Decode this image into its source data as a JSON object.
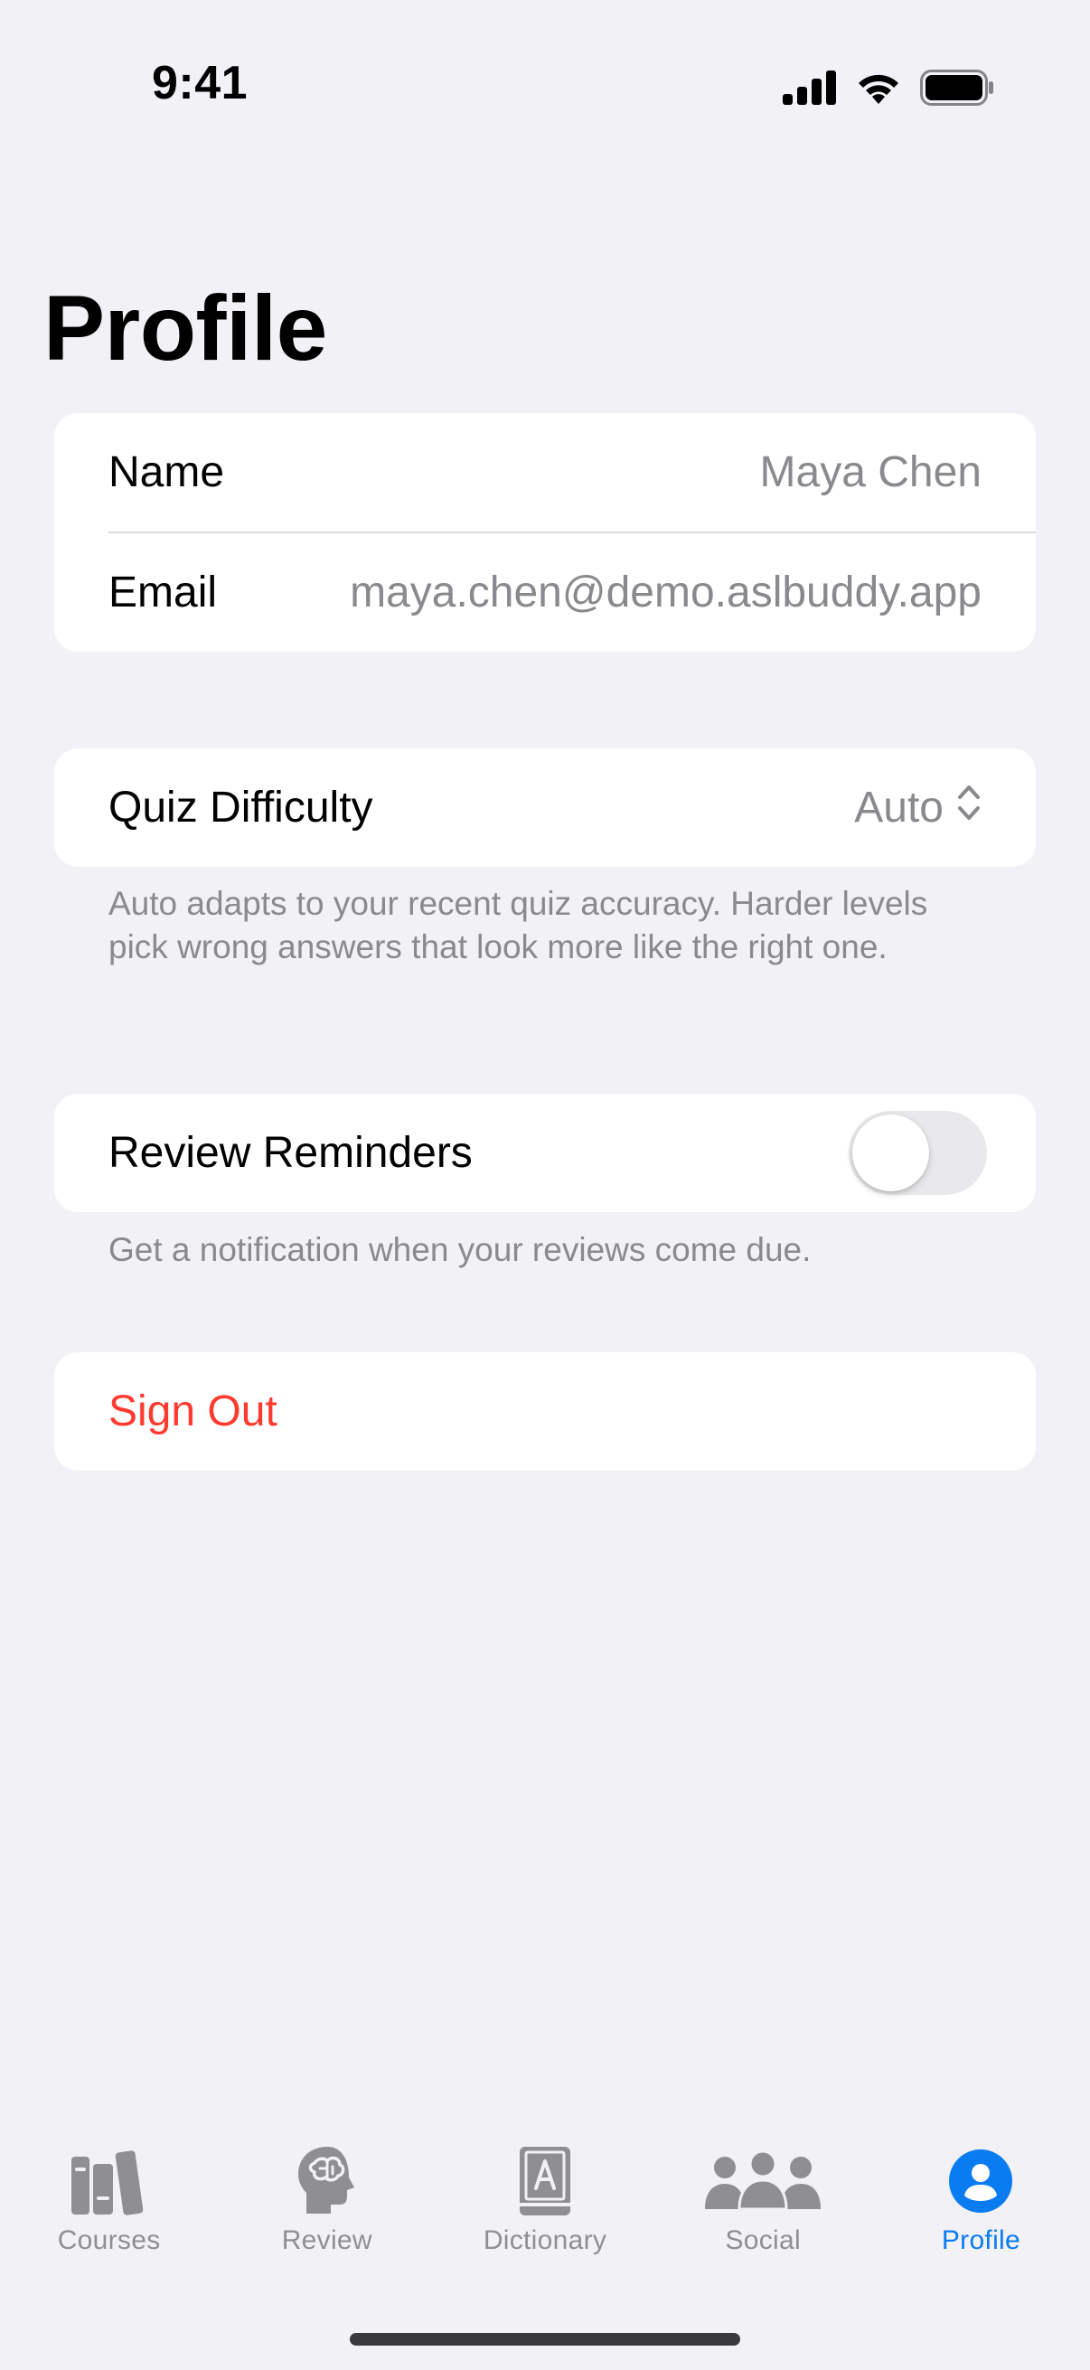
{
  "status_bar": {
    "time": "9:41"
  },
  "page": {
    "title": "Profile"
  },
  "account": {
    "name_label": "Name",
    "name_value": "Maya Chen",
    "email_label": "Email",
    "email_value": "maya.chen@demo.aslbuddy.app"
  },
  "quiz": {
    "label": "Quiz Difficulty",
    "value": "Auto",
    "footnote": "Auto adapts to your recent quiz accuracy. Harder levels pick wrong answers that look more like the right one."
  },
  "reminders": {
    "label": "Review Reminders",
    "enabled": false,
    "footnote": "Get a notification when your reviews come due."
  },
  "sign_out": {
    "label": "Sign Out"
  },
  "tabs": [
    {
      "label": "Courses",
      "icon": "books-icon",
      "active": false
    },
    {
      "label": "Review",
      "icon": "brain-head-icon",
      "active": false
    },
    {
      "label": "Dictionary",
      "icon": "dictionary-book-icon",
      "active": false
    },
    {
      "label": "Social",
      "icon": "people-icon",
      "active": false
    },
    {
      "label": "Profile",
      "icon": "person-circle-icon",
      "active": true
    }
  ],
  "colors": {
    "accent": "#0a7cf2",
    "destructive": "#ff3b30",
    "background": "#f1f1f6",
    "secondary_text": "#8a8a8e"
  }
}
